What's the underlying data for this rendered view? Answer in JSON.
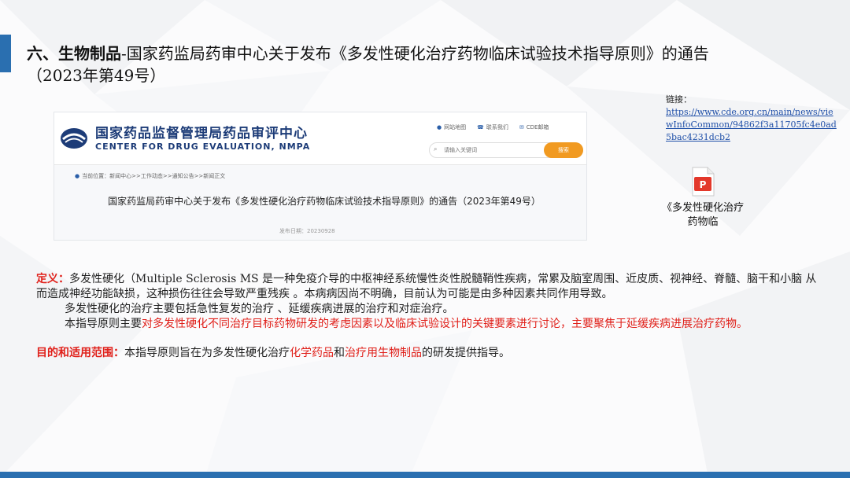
{
  "title": {
    "bold": "六、生物制品",
    "rest": "-国家药监局药审中心关于发布《多发性硬化治疗药物临床试验技术指导原则》的通告",
    "line2": "（2023年第49号）"
  },
  "link": {
    "label": "链接：",
    "url": "https://www.cde.org.cn/main/news/viewInfoCommon/94862f3a11705fc4e0ad5bac4231dcb2"
  },
  "attachment": {
    "icon": "pdf-icon",
    "label": "《多发性硬化治疗药物临"
  },
  "site": {
    "name_cn": "国家药品监督管理局药品审评中心",
    "name_en": "CENTER FOR DRUG EVALUATION, NMPA",
    "links": [
      "网站地图",
      "联系我们",
      "CDE邮箱"
    ],
    "search_placeholder": "请输入关键词",
    "search_button": "搜索",
    "breadcrumb": "当前位置：新闻中心>>工作动态>>通知公告>>新闻正文",
    "article_title": "国家药监局药审中心关于发布《多发性硬化治疗药物临床试验技术指导原则》的通告（2023年第49号）",
    "date": "发布日期：20230928"
  },
  "body": {
    "def_label": "定义：",
    "def_text": "多发性硬化（Multiple Sclerosis MS 是一种免疫介导的中枢神经系统慢性炎性脱髓鞘性疾病，常累及脑室周围、近皮质、视神经、脊髓、脑干和小脑 从而造成神经功能缺损，这种损伤往往会导致严重残疾 。本病病因尚不明确，目前认为可能是由多种因素共同作用导致。",
    "treatment": "多发性硬化的治疗主要包括急性复发的治疗 、延缓疾病进展的治疗和对症治疗。",
    "principle_prefix": "本指导原则主要",
    "principle_red": "对多发性硬化不同治疗目标药物研发的考虑因素以及临床试验设计的关键要素进行讨论，主要聚焦于延缓疾病进展治疗药物。",
    "scope_label": "目的和适用范围：",
    "scope_prefix": "本指导原则旨在为多发性硬化治疗",
    "scope_red1": "化学药品",
    "scope_and": "和",
    "scope_red2": "治疗用生物制品",
    "scope_suffix": "的研发提供指导。"
  },
  "colors": {
    "accent": "#2a6fb0",
    "highlight_red": "#e0201a",
    "site_brand": "#1d3c78",
    "search_button": "#f19a21"
  }
}
